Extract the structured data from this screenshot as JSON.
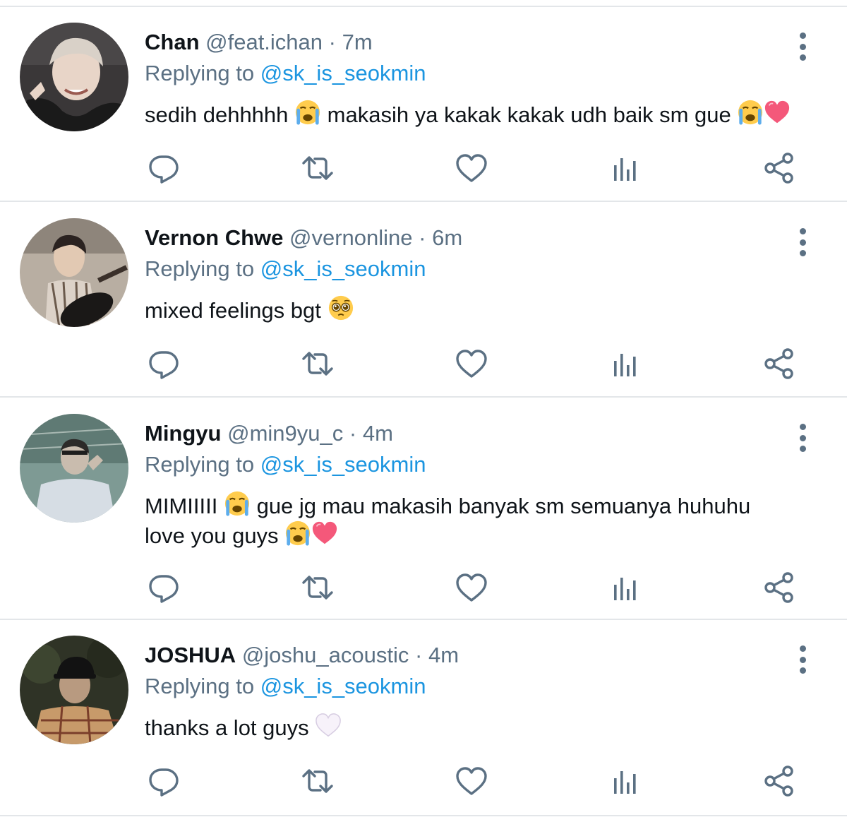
{
  "reply_prefix": "Replying to",
  "tweets": [
    {
      "name": "Chan",
      "handle": "@feat.ichan",
      "separator": "·",
      "time": "7m",
      "reply_to": "@sk_is_seokmin",
      "text_parts": [
        "sedih dehhhhh",
        "makasih ya kakak kakak udh baik sm gue"
      ],
      "emojis": [
        "loudly-crying-face",
        "loudly-crying-face",
        "pink-heart"
      ]
    },
    {
      "name": "Vernon Chwe",
      "handle": "@vernonline",
      "separator": "·",
      "time": "6m",
      "reply_to": "@sk_is_seokmin",
      "text_parts": [
        "mixed feelings bgt"
      ],
      "emojis": [
        "pleading-face"
      ]
    },
    {
      "name": "Mingyu",
      "handle": "@min9yu_c",
      "separator": "·",
      "time": "4m",
      "reply_to": "@sk_is_seokmin",
      "text_parts": [
        "MIMIIIII",
        "gue jg mau makasih banyak sm semuanya huhuhu",
        "love you guys"
      ],
      "emojis": [
        "loudly-crying-face",
        "loudly-crying-face",
        "pink-heart"
      ]
    },
    {
      "name": "JOSHUA",
      "handle": "@joshu_acoustic",
      "separator": "·",
      "time": "4m",
      "reply_to": "@sk_is_seokmin",
      "text_parts": [
        "thanks a lot guys"
      ],
      "emojis": [
        "white-heart"
      ]
    }
  ],
  "action_icons": [
    "reply-icon",
    "retweet-icon",
    "like-icon",
    "analytics-icon",
    "share-icon"
  ],
  "colors": {
    "text": "#0f1419",
    "secondary": "#5b7083",
    "mention": "#1b95e0",
    "divider": "#e3e6e9"
  }
}
